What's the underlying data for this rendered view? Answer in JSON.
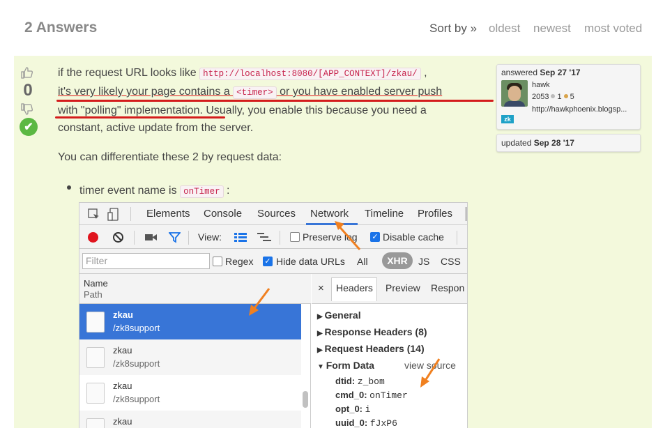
{
  "header": {
    "answers_title": "2 Answers",
    "sort_label": "Sort by »",
    "sort_options": [
      "oldest",
      "newest",
      "most voted"
    ]
  },
  "answer": {
    "vote_count": "0",
    "accepted_mark": "✔",
    "para1": {
      "t1": "if the request URL looks like ",
      "code1": "http://localhost:8080/[APP_CONTEXT]/zkau/",
      "t2": " ,",
      "t3": "it's very likely your page contains a ",
      "code2": "<timer>",
      "t4": " or you have enabled server push",
      "line3": "with \"polling\" implementation. Usually, you enable this because you need a",
      "line4": "constant, active update from the server."
    },
    "para2": "You can differentiate these 2 by request data:",
    "bullet": {
      "text": "timer event name is ",
      "code": "onTimer",
      "colon": " :"
    }
  },
  "answered_card": {
    "label": "answered ",
    "date": "Sep 27 '17",
    "user": "hawk",
    "reputation": "2053",
    "badge_silver": "1",
    "badge_bronze": "5",
    "url": "http://hawkphoenix.blogsp...",
    "badge_icon_text": "zk"
  },
  "updated_card": {
    "label": "updated ",
    "date": "Sep 28 '17"
  },
  "devtools": {
    "tabs": [
      "Elements",
      "Console",
      "Sources",
      "Network",
      "Timeline",
      "Profiles"
    ],
    "active_tab": "Network",
    "view_label": "View:",
    "preserve_log": "Preserve log",
    "disable_cache": "Disable cache",
    "filter_placeholder": "Filter",
    "regex": "Regex",
    "hide_data_urls": "Hide data URLs",
    "type_filters": [
      "All",
      "XHR",
      "JS",
      "CSS"
    ],
    "list_header": {
      "name": "Name",
      "path": "Path"
    },
    "requests": [
      {
        "name": "zkau",
        "path": "/zk8support"
      },
      {
        "name": "zkau",
        "path": "/zk8support"
      },
      {
        "name": "zkau",
        "path": "/zk8support"
      },
      {
        "name": "zkau",
        "path": ""
      }
    ],
    "detail_tabs": [
      "×",
      "Headers",
      "Preview",
      "Respon"
    ],
    "sections": [
      "General",
      "Response Headers (8)",
      "Request Headers (14)",
      "Form Data"
    ],
    "view_source": "view source",
    "form_data": [
      {
        "key": "dtid:",
        "value": "z_bom"
      },
      {
        "key": "cmd_0:",
        "value": "onTimer"
      },
      {
        "key": "opt_0:",
        "value": "i"
      },
      {
        "key": "uuid_0:",
        "value": "fJxP6"
      }
    ]
  },
  "colors": {
    "accent_bg": "#f3f9dc",
    "annotation_red": "#d41c1c",
    "arrow_orange": "#f08020",
    "selected_row": "#3875d7"
  }
}
